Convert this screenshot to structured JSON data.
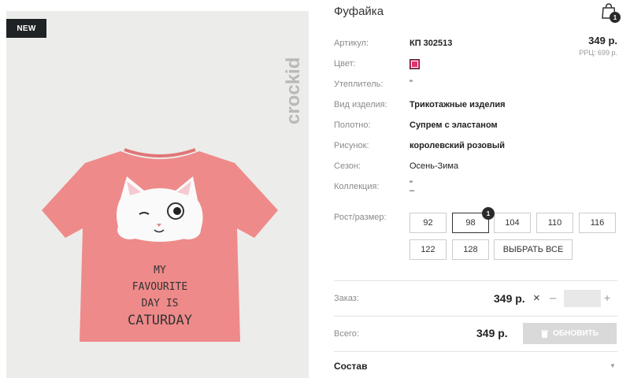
{
  "product": {
    "badge": "NEW",
    "brand": "crockid",
    "print_text": [
      "MY",
      "FAVOURITE",
      "DAY IS",
      "CATURDAY"
    ],
    "title": "Фуфайка"
  },
  "cart": {
    "count": "1"
  },
  "price": {
    "value": "349 р.",
    "rrp": "РРЦ: 699 р."
  },
  "specs": [
    {
      "label": "Артикул:",
      "value": "КП 302513"
    },
    {
      "label": "Цвет:",
      "value": ""
    },
    {
      "label": "Утеплитель:",
      "value": "\""
    },
    {
      "label": "Вид изделия:",
      "value": "Трикотажные изделия"
    },
    {
      "label": "Полотно:",
      "value": "Супрем с эластаном"
    },
    {
      "label": "Рисунок:",
      "value": "королевский розовый"
    },
    {
      "label": "Сезон:",
      "value": "Осень-Зима"
    },
    {
      "label": "Коллекция:",
      "value": "\""
    }
  ],
  "collection_line2": "–",
  "color": {
    "swatch": "#e0336e"
  },
  "sizes": {
    "label": "Рост/размер:",
    "options": [
      "92",
      "98",
      "104",
      "110",
      "116",
      "122",
      "128"
    ],
    "select_all": "ВЫБРАТЬ ВСЕ",
    "selected": "98",
    "selected_count": "1"
  },
  "order": {
    "label": "Заказ:",
    "price": "349 р.",
    "times": "×",
    "minus": "–",
    "plus": "+",
    "qty": ""
  },
  "total": {
    "label": "Всего:",
    "price": "349 р.",
    "update_label": "ОБНОВИТЬ"
  },
  "composition": {
    "title": "Состав",
    "caret": "▼"
  }
}
